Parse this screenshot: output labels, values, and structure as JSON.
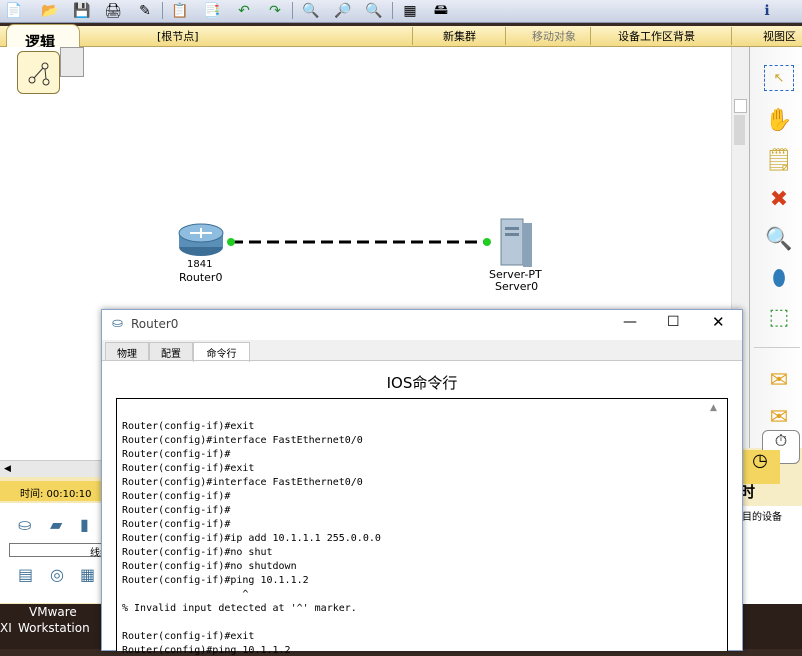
{
  "toolbar": {
    "icons": [
      "new-icon",
      "open-icon",
      "save-icon",
      "print-icon",
      "activity-wizard-icon",
      "copy-icon",
      "paste-icon",
      "undo-icon",
      "redo-icon",
      "zoom-in-icon",
      "zoom-reset-icon",
      "zoom-out-icon",
      "palette-icon",
      "custom-device-icon",
      "info-icon"
    ]
  },
  "logic_bar": {
    "tab_label": "逻辑",
    "root_node": "[根节点]",
    "new_cluster": "新集群",
    "move_object": "移动对象",
    "set_background": "设备工作区背景",
    "viewport": "视图区"
  },
  "workspace": {
    "router": {
      "model": "1841",
      "name": "Router0"
    },
    "server": {
      "model": "Server-PT",
      "name": "Server0"
    }
  },
  "bottom": {
    "time_label": "时间: 00:10:10",
    "connections_label": "线缆",
    "target_device_label": "目的设备",
    "realtime_label": "时",
    "taskbar_app": "VMware",
    "taskbar_app2": "Workstation",
    "taskbar_left": "XI"
  },
  "dialog": {
    "title": "Router0",
    "tabs": [
      "物理",
      "配置",
      "命令行"
    ],
    "active_tab": "命令行",
    "heading": "IOS命令行",
    "cli_lines": [
      "Router(config-if)#exit",
      "Router(config)#interface FastEthernet0/0",
      "Router(config-if)#",
      "Router(config-if)#exit",
      "Router(config)#interface FastEthernet0/0",
      "Router(config-if)#",
      "Router(config-if)#",
      "Router(config-if)#",
      "Router(config-if)#ip add 10.1.1.1 255.0.0.0",
      "Router(config-if)#no shut",
      "Router(config-if)#no shutdown",
      "Router(config-if)#ping 10.1.1.2",
      "                    ^",
      "% Invalid input detected at '^' marker.",
      "",
      "Router(config-if)#exit",
      "Router(config)#ping 10.1.1.2"
    ]
  },
  "colors": {
    "link_dot": "#22cc22",
    "logic_bar": "#f3dc86",
    "dialog_border": "#8ba4c9"
  }
}
